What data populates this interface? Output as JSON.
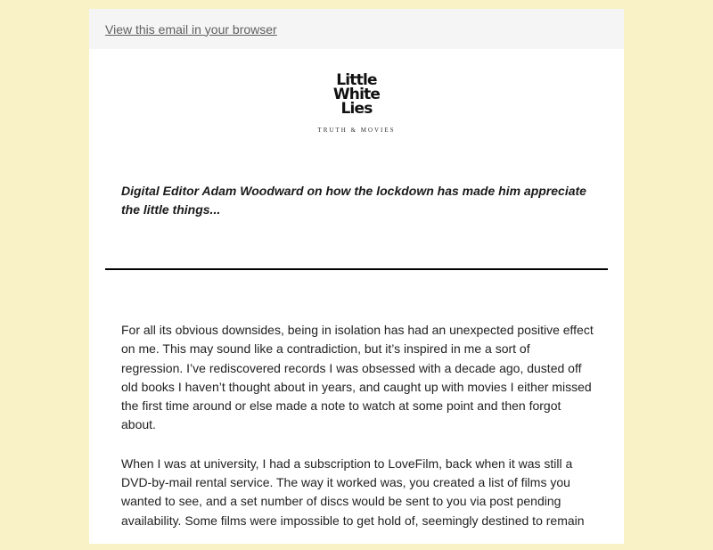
{
  "topbar": {
    "view_in_browser": "View this email in your browser"
  },
  "logo": {
    "line1": "Little",
    "line2": "White",
    "line3": "Lies",
    "tagline": "TRUTH & MOVIES"
  },
  "intro": "Digital Editor Adam Woodward on how the lockdown has made him appreciate the little things...",
  "body": {
    "paragraph1": "For all its obvious downsides, being in isolation has had an unexpected positive effect on me. This may sound like a contradiction, but it’s inspired in me a sort of regression. I’ve rediscovered records I was obsessed with a decade ago, dusted off old books I haven’t thought about in years, and caught up with movies I either missed the first time around or else made a note to watch at some point and then forgot about.",
    "paragraph2": "When I was at university, I had a subscription to LoveFilm, back when it was still a DVD-by-mail rental service. The way it worked was, you created a list of films you wanted to see, and a set number of discs would be sent to you via post pending availability. Some films were impossible to get hold of, seemingly destined to remain"
  }
}
